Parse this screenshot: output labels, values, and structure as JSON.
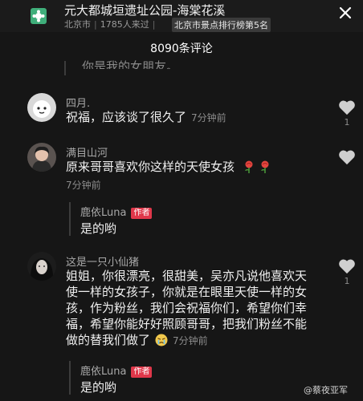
{
  "header": {
    "place_title": "元大都城垣遗址公园-海棠花溪",
    "city": "北京市",
    "visitors": "1785人来过",
    "rank": "北京市景点排行榜第5名",
    "close_icon": "close-icon"
  },
  "comments_count": "8090条评论",
  "partial_previous": "你是我的女朋友。",
  "comments": [
    {
      "user": "四月.",
      "text": "祝福，应该谈了很久了",
      "time": "7分钟前",
      "likes": "1"
    },
    {
      "user": "满目山河",
      "text": "原来哥哥喜欢你这样的天使女孩",
      "time": "7分钟前",
      "likes": "",
      "reply": {
        "user": "鹿依Luna",
        "tag": "作者",
        "text": "是的哟"
      }
    },
    {
      "user": "这是一只小仙猪",
      "lines": [
        "姐姐，你很漂亮，很甜美，吴亦凡说他喜欢天",
        "使一样的女孩子，你就是在眼里天使一样的女",
        "孩，作为粉丝，我们会祝福你们，希望你们幸",
        "福，希望你能好好照顾哥哥，把我们粉丝不能",
        "做的替我们做了"
      ],
      "time": "7分钟前",
      "likes": "1",
      "reply": {
        "user": "鹿依Luna",
        "tag": "作者",
        "text": "是的哟"
      }
    }
  ],
  "watermark": "@蔡夜亚军",
  "colors": {
    "background": "#161616",
    "author_tag": "#e0374a",
    "heart": "#cfcfcf"
  }
}
